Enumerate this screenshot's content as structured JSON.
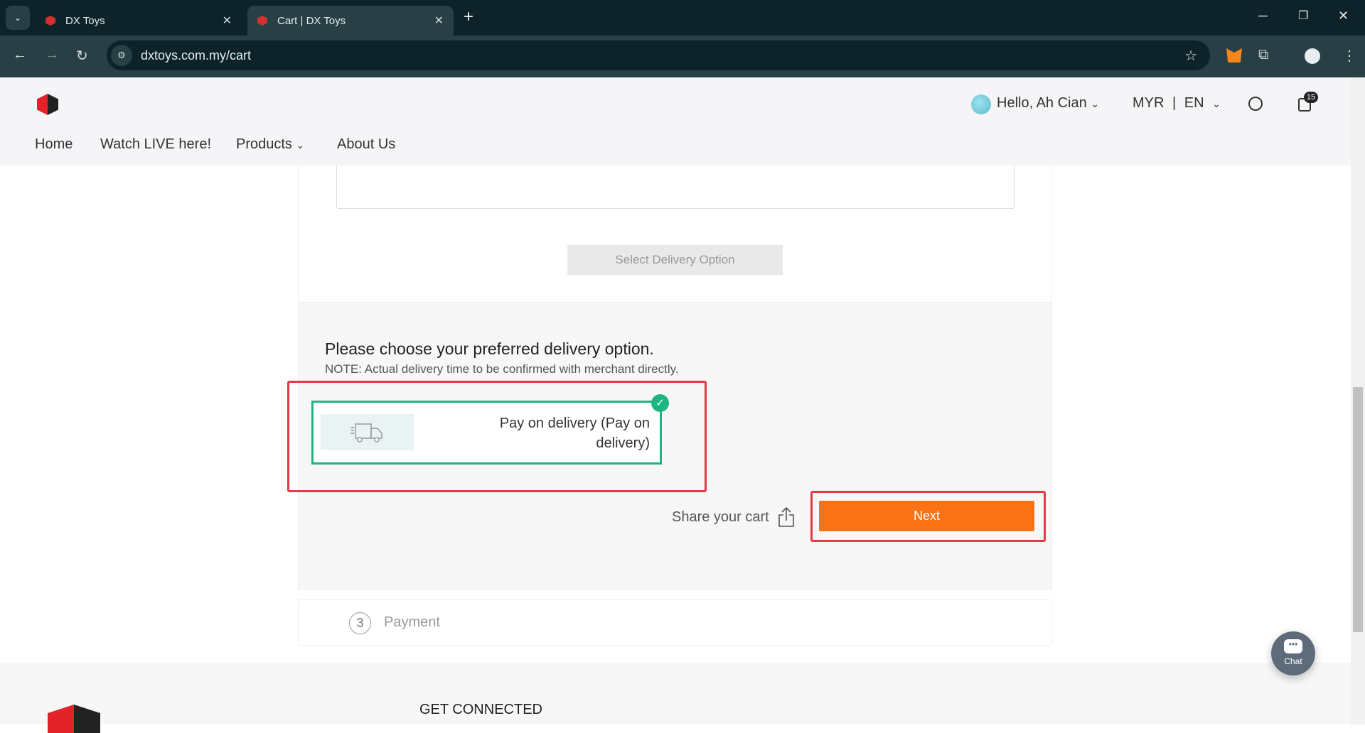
{
  "browser": {
    "tabs": [
      {
        "title": "DX Toys",
        "active": false
      },
      {
        "title": "Cart | DX Toys",
        "active": true
      }
    ],
    "url": "dxtoys.com.my/cart"
  },
  "header": {
    "nav": [
      "Home",
      "Watch LIVE here!",
      "Products",
      "About Us"
    ],
    "greeting": "Hello, Ah Cian",
    "currency": "MYR",
    "separator": "|",
    "language": "EN",
    "cart_count": "15"
  },
  "delivery": {
    "select_button": "Select Delivery Option",
    "heading": "Please choose your preferred delivery option.",
    "note": "NOTE: Actual delivery time to be confirmed with merchant directly.",
    "option_label": "Pay on delivery (Pay on delivery)",
    "option_selected": true,
    "share_label": "Share your cart",
    "next_label": "Next"
  },
  "payment_step": {
    "number": "3",
    "label": "Payment"
  },
  "footer": {
    "heading": "GET CONNECTED"
  },
  "chat": {
    "label": "Chat"
  },
  "colors": {
    "accent": "#f97316",
    "selected": "#1db584",
    "highlight": "#e53945"
  }
}
